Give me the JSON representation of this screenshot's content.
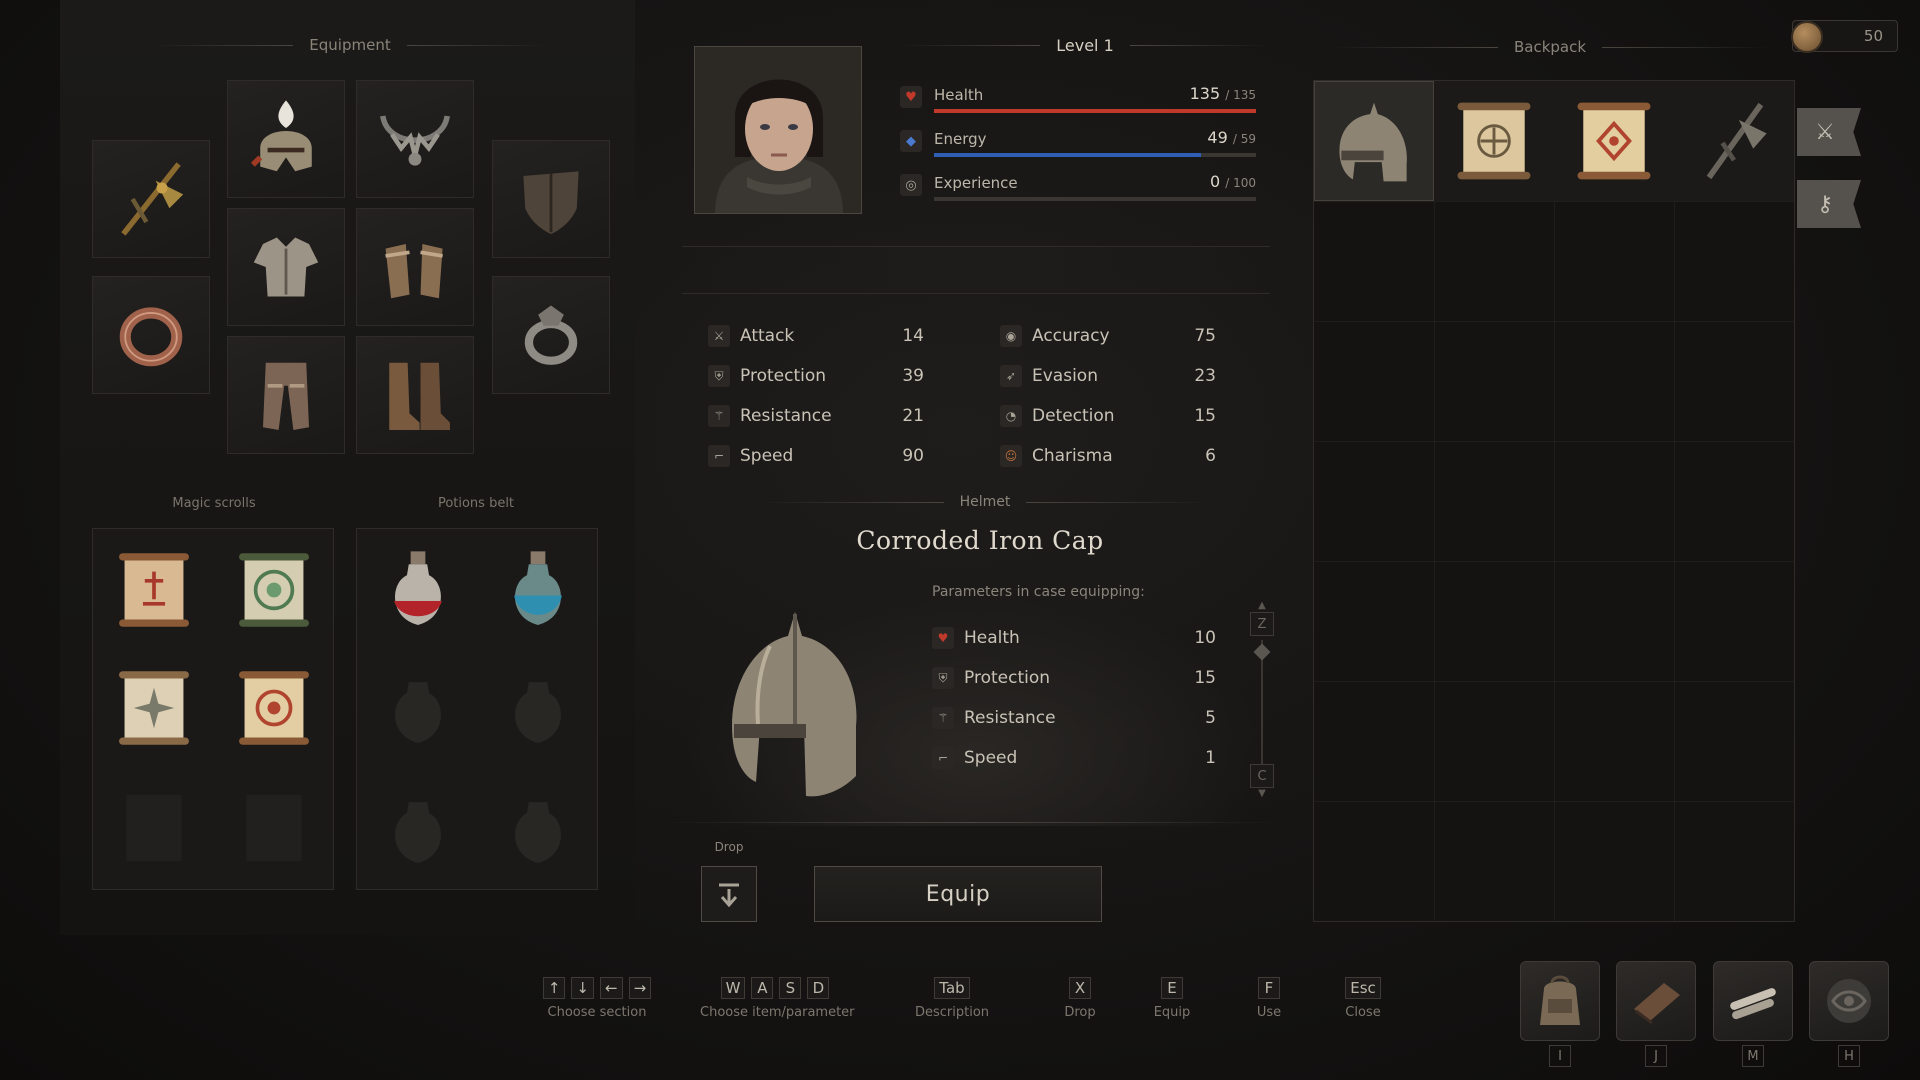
{
  "equipment": {
    "title": "Equipment",
    "slots": [
      "crossbow",
      "helmet",
      "necklace",
      "shield",
      "armor",
      "gloves",
      "ring-copper",
      "ring-silver",
      "leggings",
      "boots"
    ]
  },
  "magic_scrolls": {
    "title": "Magic scrolls"
  },
  "potions_belt": {
    "title": "Potions belt"
  },
  "character": {
    "level": "Level 1",
    "health": {
      "label": "Health",
      "value": "135",
      "max": "/ 135",
      "fill": 1.0
    },
    "energy": {
      "label": "Energy",
      "value": "49",
      "max": "/ 59",
      "fill": 0.83
    },
    "experience": {
      "label": "Experience",
      "value": "0",
      "max": "/ 100",
      "fill": 0.0
    }
  },
  "stats_left": [
    {
      "name": "Attack",
      "value": "14"
    },
    {
      "name": "Protection",
      "value": "39"
    },
    {
      "name": "Resistance",
      "value": "21"
    },
    {
      "name": "Speed",
      "value": "90"
    }
  ],
  "stats_right": [
    {
      "name": "Accuracy",
      "value": "75"
    },
    {
      "name": "Evasion",
      "value": "23"
    },
    {
      "name": "Detection",
      "value": "15"
    },
    {
      "name": "Charisma",
      "value": "6"
    }
  ],
  "item": {
    "category": "Helmet",
    "name": "Corroded Iron Cap",
    "params_title": "Parameters in case equipping:",
    "params": [
      {
        "name": "Health",
        "value": "10"
      },
      {
        "name": "Protection",
        "value": "15"
      },
      {
        "name": "Resistance",
        "value": "5"
      },
      {
        "name": "Speed",
        "value": "1"
      }
    ],
    "scroll_up_key": "Z",
    "scroll_down_key": "C"
  },
  "actions": {
    "drop_label": "Drop",
    "equip_label": "Equip"
  },
  "backpack": {
    "title": "Backpack",
    "gold": "50"
  },
  "hints": [
    {
      "keys": [
        "↑",
        "↓",
        "←",
        "→"
      ],
      "label": "Choose section"
    },
    {
      "keys": [
        "W",
        "A",
        "S",
        "D"
      ],
      "label": "Choose item/parameter"
    },
    {
      "keys": [
        "Tab"
      ],
      "label": "Description"
    },
    {
      "keys": [
        "X"
      ],
      "label": "Drop"
    },
    {
      "keys": [
        "E"
      ],
      "label": "Equip"
    },
    {
      "keys": [
        "F"
      ],
      "label": "Use"
    },
    {
      "keys": [
        "Esc"
      ],
      "label": "Close"
    }
  ],
  "quick_menu": [
    {
      "icon": "backpack-icon",
      "key": "I"
    },
    {
      "icon": "journal-icon",
      "key": "J"
    },
    {
      "icon": "map-scrolls-icon",
      "key": "M"
    },
    {
      "icon": "emblem-icon",
      "key": "H"
    }
  ],
  "colors": {
    "health": "#c0392b",
    "energy": "#2f5fb3",
    "experience": "#5a5650"
  }
}
